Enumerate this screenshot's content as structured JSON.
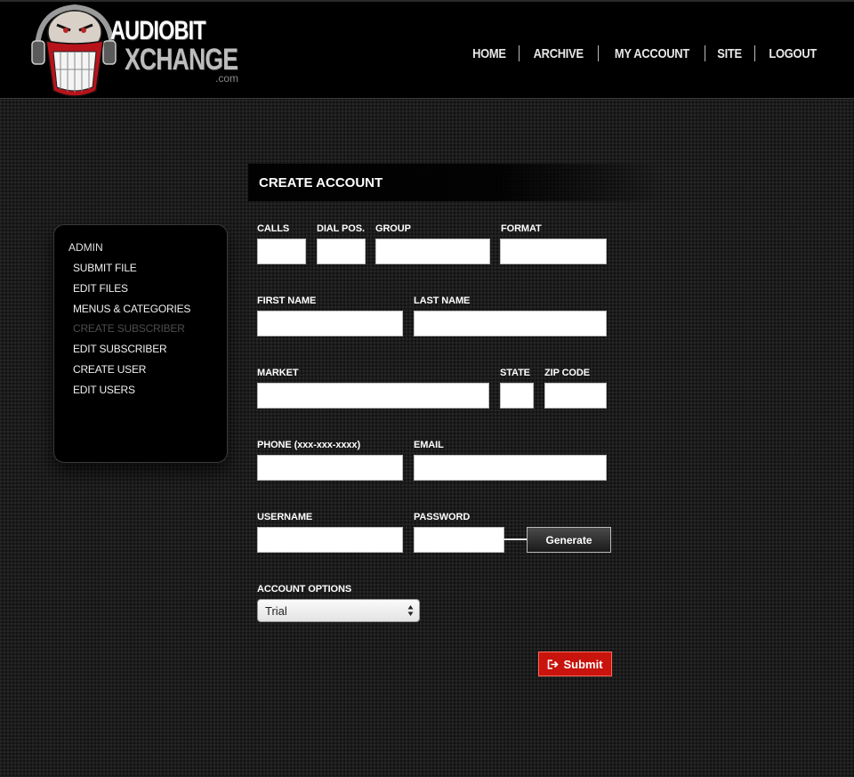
{
  "brand": {
    "line1": "AUDIOBIT",
    "line2": "XCHANGE",
    "suffix": ".com"
  },
  "nav": {
    "items": [
      "HOME",
      "ARCHIVE",
      "MY ACCOUNT",
      "SITE",
      "LOGOUT"
    ]
  },
  "sidebar": {
    "heading": "ADMIN",
    "items": [
      {
        "label": "SUBMIT FILE"
      },
      {
        "label": "EDIT FILES"
      },
      {
        "label": "MENUS & CATEGORIES"
      },
      {
        "label": "CREATE SUBSCRIBER",
        "active": true
      },
      {
        "label": "EDIT SUBSCRIBER"
      },
      {
        "label": "CREATE USER"
      },
      {
        "label": "EDIT USERS"
      }
    ]
  },
  "form": {
    "title": "CREATE ACCOUNT",
    "labels": {
      "calls": "CALLS",
      "dial_pos": "DIAL POS.",
      "group": "GROUP",
      "format": "FORMAT",
      "first_name": "FIRST NAME",
      "last_name": "LAST NAME",
      "market": "MARKET",
      "state": "STATE",
      "zip_code": "ZIP CODE",
      "phone": "PHONE (xxx-xxx-xxxx)",
      "email": "EMAIL",
      "username": "USERNAME",
      "password": "PASSWORD",
      "account_options": "ACCOUNT OPTIONS"
    },
    "values": {
      "calls": "",
      "dial_pos": "",
      "group": "",
      "format": "",
      "first_name": "",
      "last_name": "",
      "market": "",
      "state": "",
      "zip_code": "",
      "phone": "",
      "email": "",
      "username": "",
      "password": ""
    },
    "account_option_selected": "Trial",
    "generate_label": "Generate",
    "submit_label": "Submit"
  },
  "colors": {
    "header_bg": "#000000",
    "page_bg": "#1c1c1c",
    "submit_bg": "#c8140c",
    "disabled_text": "#4d4d4d"
  },
  "icons": {
    "logo": "grinning-face-headphones-icon",
    "submit": "sign-out-arrow-icon",
    "select": "updown-arrows-icon"
  }
}
